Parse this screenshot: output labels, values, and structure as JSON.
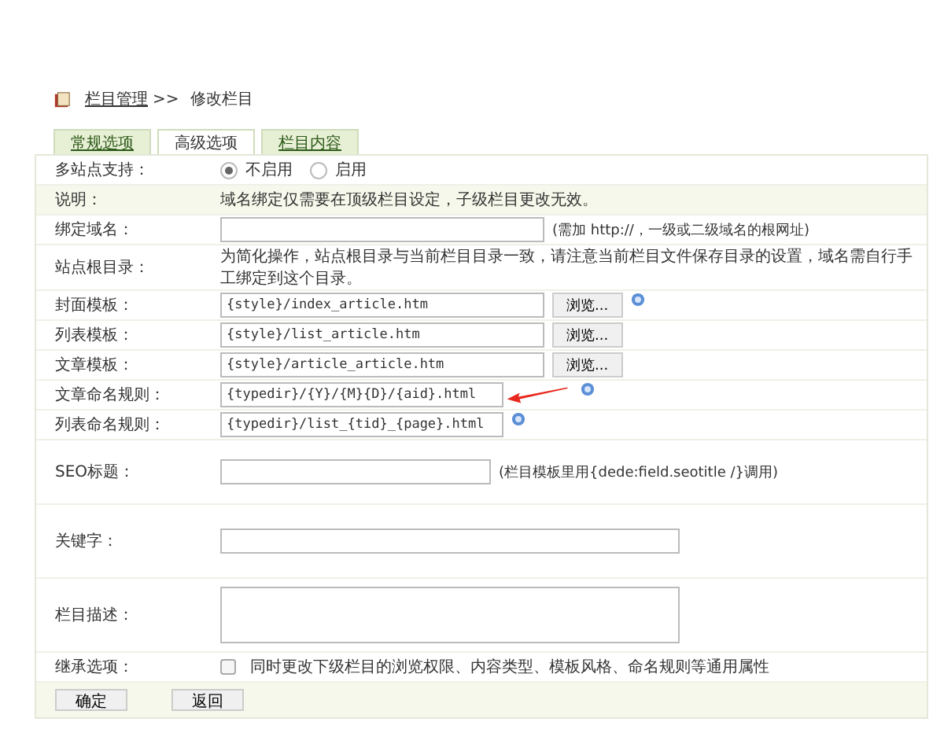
{
  "breadcrumb": {
    "link": "栏目管理",
    "separator": ">>",
    "current": "修改栏目"
  },
  "tabs": [
    {
      "label": "常规选项",
      "selected": false
    },
    {
      "label": "高级选项",
      "selected": true
    },
    {
      "label": "栏目内容",
      "selected": false
    }
  ],
  "rows": [
    {
      "kind": "radio",
      "label": "多站点支持：",
      "options": [
        {
          "label": "不启用",
          "selected": true
        },
        {
          "label": "启用",
          "selected": false
        }
      ]
    },
    {
      "kind": "note",
      "label": "说明：",
      "text": "域名绑定仅需要在顶级栏目设定，子级栏目更改无效。"
    },
    {
      "kind": "input",
      "label": "绑定域名：",
      "value": "",
      "hint": "(需加 http://，一级或二级域名的根网址)"
    },
    {
      "kind": "text",
      "label": "站点根目录：",
      "text": "为简化操作，站点根目录与当前栏目目录一致，请注意当前栏目文件保存目录的设置，域名需自行手工绑定到这个目录。"
    },
    {
      "kind": "input",
      "label": "封面模板：",
      "value": "{style}/index_article.htm",
      "browse": "浏览...",
      "help": true
    },
    {
      "kind": "input",
      "label": "列表模板：",
      "value": "{style}/list_article.htm",
      "browse": "浏览..."
    },
    {
      "kind": "input",
      "label": "文章模板：",
      "value": "{style}/article_article.htm",
      "browse": "浏览..."
    },
    {
      "kind": "input",
      "label": "文章命名规则：",
      "value": "{typedir}/{Y}/{M}{D}/{aid}.html",
      "help": true,
      "arrow": true
    },
    {
      "kind": "input",
      "label": "列表命名规则：",
      "value": "{typedir}/list_{tid}_{page}.html",
      "help": true
    },
    {
      "kind": "input",
      "label": "SEO标题：",
      "value": "",
      "hint": "(栏目模板里用{dede:field.seotitle /}调用)"
    },
    {
      "kind": "textarea",
      "label": "关键字：",
      "value": ""
    },
    {
      "kind": "memo",
      "label": "栏目描述：",
      "value": ""
    },
    {
      "kind": "checkbox",
      "label": "继承选项：",
      "checked": false,
      "text": "同时更改下级栏目的浏览权限、内容类型、模板风格、命名规则等通用属性"
    }
  ],
  "buttons": [
    "确定",
    "返回"
  ]
}
